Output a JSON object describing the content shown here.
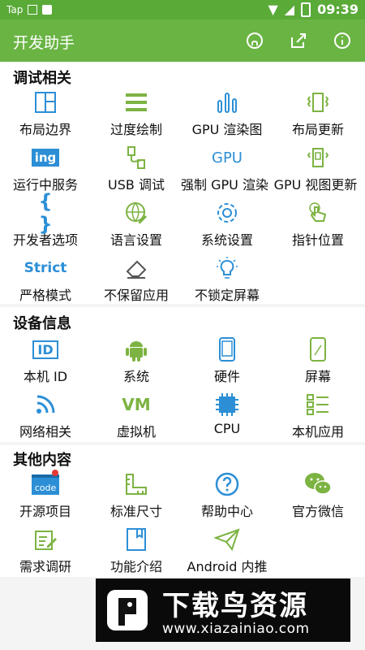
{
  "status": {
    "carrier": "Tap",
    "time": "09:39"
  },
  "toolbar": {
    "title": "开发助手"
  },
  "sections": [
    {
      "title": "调试相关",
      "items": [
        "布局边界",
        "过度绘制",
        "GPU 渲染图",
        "布局更新",
        "运行中服务",
        "USB 调试",
        "强制 GPU 渲染",
        "GPU 视图更新",
        "开发者选项",
        "语言设置",
        "系统设置",
        "指针位置",
        "严格模式",
        "不保留应用",
        "不锁定屏幕"
      ]
    },
    {
      "title": "设备信息",
      "items": [
        "本机 ID",
        "系统",
        "硬件",
        "屏幕",
        "网络相关",
        "虚拟机",
        "CPU",
        "本机应用"
      ]
    },
    {
      "title": "其他内容",
      "items": [
        "开源项目",
        "标准尺寸",
        "帮助中心",
        "官方微信",
        "需求调研",
        "功能介绍",
        "Android 内推"
      ]
    }
  ],
  "icon_text": {
    "ing": "ing",
    "gpu": "GPU",
    "strict": "Strict",
    "vm": "VM",
    "id": "ID",
    "code": "code",
    "braces": "{ }"
  },
  "banner": {
    "title": "下载鸟资源",
    "url": "www.xiazainiao.com"
  },
  "colors": {
    "accent": "#6ab444",
    "icon": "#2c8fd6",
    "green": "#7cb342"
  }
}
